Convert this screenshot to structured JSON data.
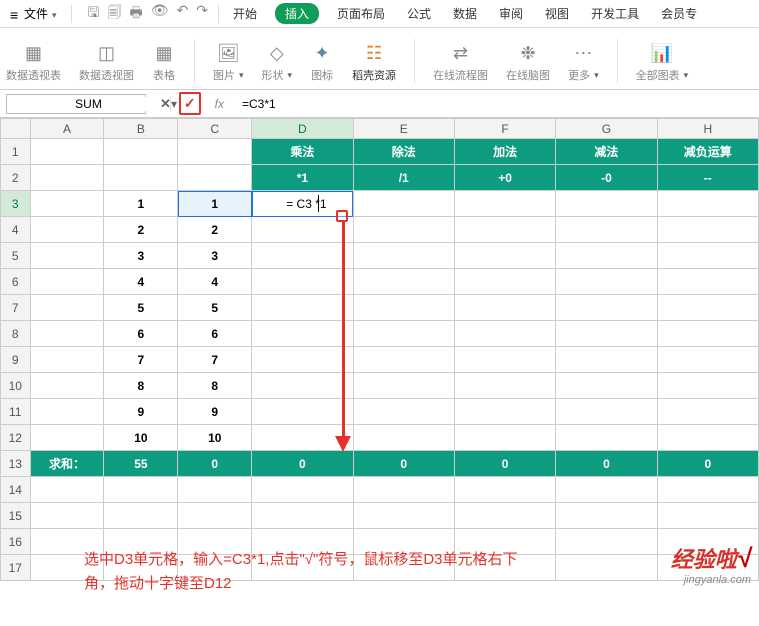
{
  "menubar": {
    "file_label": "文件",
    "tabs": [
      "开始",
      "插入",
      "页面布局",
      "公式",
      "数据",
      "审阅",
      "视图",
      "开发工具",
      "会员专"
    ],
    "active_tab_index": 1
  },
  "ribbon": {
    "pivot_table": "数据透视表",
    "pivot_chart": "数据透视图",
    "table": "表格",
    "picture": "图片",
    "shape": "形状",
    "icon": "图标",
    "docer": "稻壳资源",
    "flowchart": "在线流程图",
    "mindmap": "在线脑图",
    "more": "更多",
    "all_charts": "全部图表"
  },
  "formula_bar": {
    "namebox": "SUM",
    "formula": "=C3*1"
  },
  "columns": [
    "A",
    "B",
    "C",
    "D",
    "E",
    "F",
    "G",
    "H"
  ],
  "rows_count": 17,
  "header_row1": {
    "D": "乘法",
    "E": "除法",
    "F": "加法",
    "G": "减法",
    "H": "减负运算"
  },
  "header_row2": {
    "D": "*1",
    "E": "/1",
    "F": "+0",
    "G": "-0",
    "H": "--"
  },
  "data_B": [
    "1",
    "2",
    "3",
    "4",
    "5",
    "6",
    "7",
    "8",
    "9",
    "10"
  ],
  "data_C": [
    "1",
    "2",
    "3",
    "4",
    "5",
    "6",
    "7",
    "8",
    "9",
    "10"
  ],
  "editing_cell": "= C3 *1",
  "sum_row": {
    "label": "求和：",
    "B": "55",
    "C": "0",
    "D": "0",
    "E": "0",
    "F": "0",
    "G": "0",
    "H": "0"
  },
  "instruction_line1": "选中D3单元格，输入=C3*1,点击\"√\"符号，鼠标移至D3单元格右下",
  "instruction_line2": "角，拖动十字键至D12",
  "watermark": {
    "brand": "经验啦",
    "check": "√",
    "url": "jingyanla.com"
  },
  "chart_data": {
    "type": "table",
    "title": "Text-to-number conversion operations",
    "columns": [
      "B",
      "C",
      "乘法 *1",
      "除法 /1",
      "加法 +0",
      "减法 -0",
      "减负运算 --"
    ],
    "rows": [
      [
        1,
        1,
        null,
        null,
        null,
        null,
        null
      ],
      [
        2,
        2,
        null,
        null,
        null,
        null,
        null
      ],
      [
        3,
        3,
        null,
        null,
        null,
        null,
        null
      ],
      [
        4,
        4,
        null,
        null,
        null,
        null,
        null
      ],
      [
        5,
        5,
        null,
        null,
        null,
        null,
        null
      ],
      [
        6,
        6,
        null,
        null,
        null,
        null,
        null
      ],
      [
        7,
        7,
        null,
        null,
        null,
        null,
        null
      ],
      [
        8,
        8,
        null,
        null,
        null,
        null,
        null
      ],
      [
        9,
        9,
        null,
        null,
        null,
        null,
        null
      ],
      [
        10,
        10,
        null,
        null,
        null,
        null,
        null
      ]
    ],
    "sum_row": {
      "label": "求和：",
      "values": [
        55,
        0,
        0,
        0,
        0,
        0,
        0
      ]
    },
    "active_formula_cell": {
      "ref": "D3",
      "formula": "=C3*1"
    }
  }
}
